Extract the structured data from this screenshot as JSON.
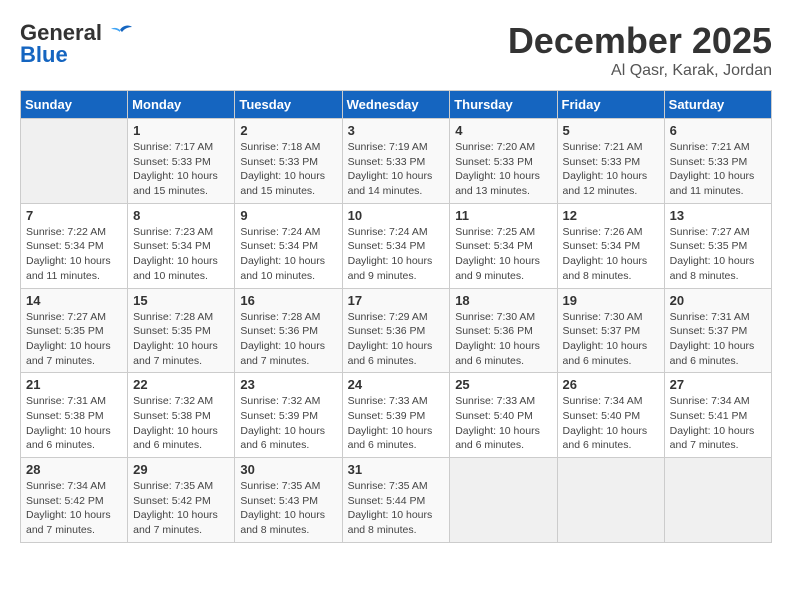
{
  "header": {
    "logo_line1": "General",
    "logo_line2": "Blue",
    "month": "December 2025",
    "location": "Al Qasr, Karak, Jordan"
  },
  "weekdays": [
    "Sunday",
    "Monday",
    "Tuesday",
    "Wednesday",
    "Thursday",
    "Friday",
    "Saturday"
  ],
  "weeks": [
    [
      {
        "day": "",
        "info": ""
      },
      {
        "day": "1",
        "info": "Sunrise: 7:17 AM\nSunset: 5:33 PM\nDaylight: 10 hours\nand 15 minutes."
      },
      {
        "day": "2",
        "info": "Sunrise: 7:18 AM\nSunset: 5:33 PM\nDaylight: 10 hours\nand 15 minutes."
      },
      {
        "day": "3",
        "info": "Sunrise: 7:19 AM\nSunset: 5:33 PM\nDaylight: 10 hours\nand 14 minutes."
      },
      {
        "day": "4",
        "info": "Sunrise: 7:20 AM\nSunset: 5:33 PM\nDaylight: 10 hours\nand 13 minutes."
      },
      {
        "day": "5",
        "info": "Sunrise: 7:21 AM\nSunset: 5:33 PM\nDaylight: 10 hours\nand 12 minutes."
      },
      {
        "day": "6",
        "info": "Sunrise: 7:21 AM\nSunset: 5:33 PM\nDaylight: 10 hours\nand 11 minutes."
      }
    ],
    [
      {
        "day": "7",
        "info": "Sunrise: 7:22 AM\nSunset: 5:34 PM\nDaylight: 10 hours\nand 11 minutes."
      },
      {
        "day": "8",
        "info": "Sunrise: 7:23 AM\nSunset: 5:34 PM\nDaylight: 10 hours\nand 10 minutes."
      },
      {
        "day": "9",
        "info": "Sunrise: 7:24 AM\nSunset: 5:34 PM\nDaylight: 10 hours\nand 10 minutes."
      },
      {
        "day": "10",
        "info": "Sunrise: 7:24 AM\nSunset: 5:34 PM\nDaylight: 10 hours\nand 9 minutes."
      },
      {
        "day": "11",
        "info": "Sunrise: 7:25 AM\nSunset: 5:34 PM\nDaylight: 10 hours\nand 9 minutes."
      },
      {
        "day": "12",
        "info": "Sunrise: 7:26 AM\nSunset: 5:34 PM\nDaylight: 10 hours\nand 8 minutes."
      },
      {
        "day": "13",
        "info": "Sunrise: 7:27 AM\nSunset: 5:35 PM\nDaylight: 10 hours\nand 8 minutes."
      }
    ],
    [
      {
        "day": "14",
        "info": "Sunrise: 7:27 AM\nSunset: 5:35 PM\nDaylight: 10 hours\nand 7 minutes."
      },
      {
        "day": "15",
        "info": "Sunrise: 7:28 AM\nSunset: 5:35 PM\nDaylight: 10 hours\nand 7 minutes."
      },
      {
        "day": "16",
        "info": "Sunrise: 7:28 AM\nSunset: 5:36 PM\nDaylight: 10 hours\nand 7 minutes."
      },
      {
        "day": "17",
        "info": "Sunrise: 7:29 AM\nSunset: 5:36 PM\nDaylight: 10 hours\nand 6 minutes."
      },
      {
        "day": "18",
        "info": "Sunrise: 7:30 AM\nSunset: 5:36 PM\nDaylight: 10 hours\nand 6 minutes."
      },
      {
        "day": "19",
        "info": "Sunrise: 7:30 AM\nSunset: 5:37 PM\nDaylight: 10 hours\nand 6 minutes."
      },
      {
        "day": "20",
        "info": "Sunrise: 7:31 AM\nSunset: 5:37 PM\nDaylight: 10 hours\nand 6 minutes."
      }
    ],
    [
      {
        "day": "21",
        "info": "Sunrise: 7:31 AM\nSunset: 5:38 PM\nDaylight: 10 hours\nand 6 minutes."
      },
      {
        "day": "22",
        "info": "Sunrise: 7:32 AM\nSunset: 5:38 PM\nDaylight: 10 hours\nand 6 minutes."
      },
      {
        "day": "23",
        "info": "Sunrise: 7:32 AM\nSunset: 5:39 PM\nDaylight: 10 hours\nand 6 minutes."
      },
      {
        "day": "24",
        "info": "Sunrise: 7:33 AM\nSunset: 5:39 PM\nDaylight: 10 hours\nand 6 minutes."
      },
      {
        "day": "25",
        "info": "Sunrise: 7:33 AM\nSunset: 5:40 PM\nDaylight: 10 hours\nand 6 minutes."
      },
      {
        "day": "26",
        "info": "Sunrise: 7:34 AM\nSunset: 5:40 PM\nDaylight: 10 hours\nand 6 minutes."
      },
      {
        "day": "27",
        "info": "Sunrise: 7:34 AM\nSunset: 5:41 PM\nDaylight: 10 hours\nand 7 minutes."
      }
    ],
    [
      {
        "day": "28",
        "info": "Sunrise: 7:34 AM\nSunset: 5:42 PM\nDaylight: 10 hours\nand 7 minutes."
      },
      {
        "day": "29",
        "info": "Sunrise: 7:35 AM\nSunset: 5:42 PM\nDaylight: 10 hours\nand 7 minutes."
      },
      {
        "day": "30",
        "info": "Sunrise: 7:35 AM\nSunset: 5:43 PM\nDaylight: 10 hours\nand 8 minutes."
      },
      {
        "day": "31",
        "info": "Sunrise: 7:35 AM\nSunset: 5:44 PM\nDaylight: 10 hours\nand 8 minutes."
      },
      {
        "day": "",
        "info": ""
      },
      {
        "day": "",
        "info": ""
      },
      {
        "day": "",
        "info": ""
      }
    ]
  ]
}
